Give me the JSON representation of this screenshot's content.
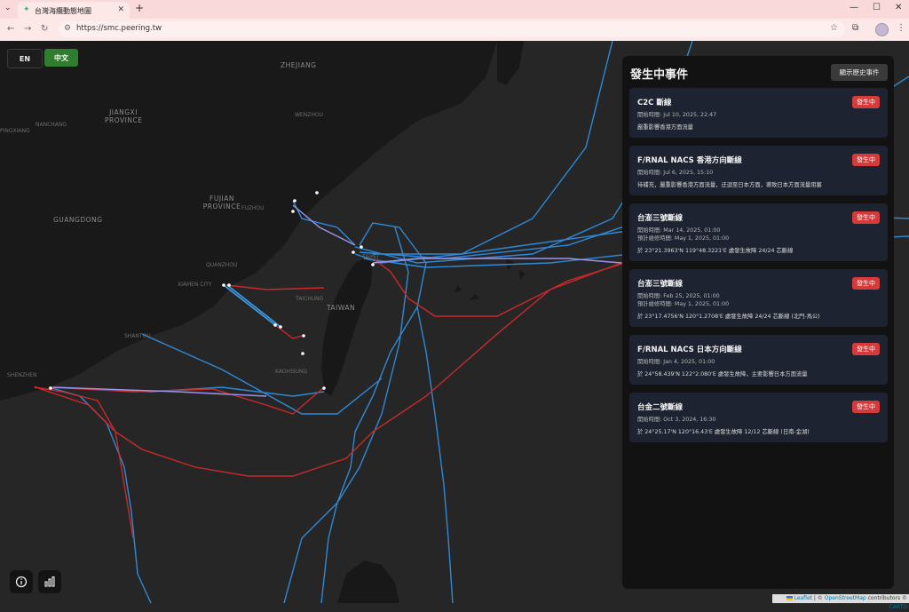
{
  "browser": {
    "tab_title": "台灣海纜動態地圖",
    "url": "https://smc.peering.tw"
  },
  "map": {
    "labels": {
      "zhejiang": "ZHEJIANG",
      "jiangxi": "JIANGXI PROVINCE",
      "fujian": "FUJIAN PROVINCE",
      "taiwan": "TAIWAN",
      "guangdong": "GUANGDONG",
      "quanzhou": "QUANZHOU",
      "xiamen": "XIAMEN CITY",
      "fuzhou": "FUZHOU",
      "wenzhou": "WENZHOU",
      "nanchang": "NANCHANG",
      "taipei": "TAIPEI",
      "taichung": "TAICHUNG",
      "kaohsiung": "KAOHSIUNG",
      "shenzhen": "SHENZHEN",
      "shantou": "SHANTOU",
      "pingxiang": "PINGXIANG"
    },
    "attribution": {
      "leaflet": "Leaflet",
      "sep1": " | © ",
      "osm": "OpenStreetMap",
      "mid": " contributors © ",
      "carto": "CARTO"
    },
    "cable_colors": {
      "active": "#2f8fe0",
      "fault": "#d42a2a",
      "planned": "#8f8fe8"
    }
  },
  "lang": {
    "en": "EN",
    "zh": "中文"
  },
  "panel": {
    "title": "發生中事件",
    "history_button": "顯示歷史事件",
    "events": [
      {
        "title": "C2C 斷線",
        "badge": "發生中",
        "start": "開始時間: Jul 10, 2025, 22:47",
        "repair": "",
        "desc": "嚴重影響香港方面流量"
      },
      {
        "title": "F/RNAL NACS 香港方向斷線",
        "badge": "發生中",
        "start": "開始時間: Jul 6, 2025, 15:10",
        "repair": "",
        "desc": "待補充，嚴重影響香港方面流量，迂迴至日本方面，導致日本方面流量阻塞"
      },
      {
        "title": "台澎三號斷線",
        "badge": "發生中",
        "start": "開始時間: Mar 14, 2025, 01:00",
        "repair": "預計維修時間: May 1, 2025, 01:00",
        "desc": "於 23°21.3963'N 119°48.3221'E 處發生故障 24/24 芯斷線"
      },
      {
        "title": "台澎三號斷線",
        "badge": "發生中",
        "start": "開始時間: Feb 25, 2025, 01:00",
        "repair": "預計維修時間: May 1, 2025, 01:00",
        "desc": "於 23°17.4756'N 120°1.2708'E 處發生故障 24/24 芯斷線 (北門-馬公)"
      },
      {
        "title": "F/RNAL NACS 日本方向斷線",
        "badge": "發生中",
        "start": "開始時間: Jan 4, 2025, 01:00",
        "repair": "",
        "desc": "於 24°58.439'N 122°2.080'E 處發生故障，主要影響日本方面流量"
      },
      {
        "title": "台金二號斷線",
        "badge": "發生中",
        "start": "開始時間: Oct 3, 2024, 16:30",
        "repair": "",
        "desc": "於 24°25.17'N 120°16.43'E 處發生故障 12/12 芯斷線 (日南-金湖)"
      }
    ]
  }
}
